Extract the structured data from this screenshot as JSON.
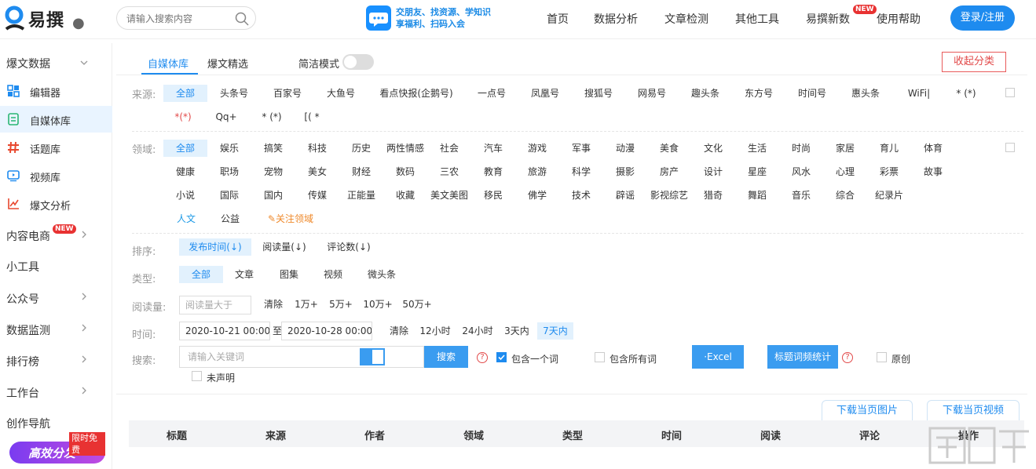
{
  "header": {
    "logo_text": "易撰",
    "search_placeholder": "请输入搜索内容",
    "promo_line1": "交朋友、找资源、学知识",
    "promo_line2": "享福利、扫码入会",
    "nav": [
      "首页",
      "数据分析",
      "文章检测",
      "其他工具",
      "易撰新数",
      "使用帮助"
    ],
    "new_badge": "NEW",
    "login_label": "登录/注册"
  },
  "sidebar": {
    "section_title": "爆文数据",
    "items": [
      {
        "label": "编辑器",
        "icon": "grid-icon"
      },
      {
        "label": "自媒体库",
        "icon": "document-icon"
      },
      {
        "label": "话题库",
        "icon": "hashtag-icon"
      },
      {
        "label": "视频库",
        "icon": "video-icon"
      },
      {
        "label": "爆文分析",
        "icon": "chart-icon"
      }
    ],
    "groups": [
      "内容电商",
      "小工具",
      "公众号",
      "数据监测",
      "排行榜",
      "工作台",
      "创作导航"
    ],
    "new_badge": "NEW",
    "promo_text": "高效分发",
    "promo_badge": "限时免费"
  },
  "tabs": {
    "items": [
      "自媒体库",
      "爆文精选"
    ],
    "toggle_label": "简洁模式",
    "collapse_label": "收起分类"
  },
  "filters": {
    "source_label": "来源:",
    "sources_row1": [
      "全部",
      "头条号",
      "百家号",
      "大鱼号",
      "看点快报(企鹅号)",
      "一点号",
      "凤凰号",
      "搜狐号",
      "网易号",
      "趣头条",
      "东方号",
      "时间号",
      "惠头条",
      "WiFi|",
      "* (*)"
    ],
    "sources_row2": [
      "*(*)",
      "Qq+",
      "* (*)",
      "[( *"
    ],
    "domain_label": "领域:",
    "domains_row1": [
      "全部",
      "娱乐",
      "搞笑",
      "科技",
      "历史",
      "两性情感",
      "社会",
      "汽车",
      "游戏",
      "军事",
      "动漫",
      "美食",
      "文化",
      "生活",
      "时尚",
      "家居",
      "育儿",
      "体育"
    ],
    "domains_row2": [
      "健康",
      "职场",
      "宠物",
      "美女",
      "财经",
      "数码",
      "三农",
      "教育",
      "旅游",
      "科学",
      "摄影",
      "房产",
      "设计",
      "星座",
      "风水",
      "心理",
      "彩票",
      "故事"
    ],
    "domains_row3": [
      "小说",
      "国际",
      "国内",
      "传媒",
      "正能量",
      "收藏",
      "美文美图",
      "移民",
      "佛学",
      "技术",
      "辟谣",
      "影视综艺",
      "猎奇",
      "舞蹈",
      "音乐",
      "综合",
      "纪录片"
    ],
    "domains_row4": [
      "人文",
      "公益"
    ],
    "follow_domain": "关注领域",
    "sort_label": "排序:",
    "sorts": [
      "发布时间(↓)",
      "阅读量(↓)",
      "评论数(↓)"
    ],
    "type_label": "类型:",
    "types": [
      "全部",
      "文章",
      "图集",
      "视频",
      "微头条"
    ],
    "reads_label": "阅读量:",
    "reads_placeholder": "阅读量大于",
    "reads_clear": "清除",
    "reads_opts": [
      "1万+",
      "5万+",
      "10万+",
      "50万+"
    ],
    "time_label": "时间:",
    "time_start": "2020-10-21 00:00",
    "time_to": "至",
    "time_end": "2020-10-28 00:00",
    "time_clear": "清除",
    "time_opts": [
      "12小时",
      "24小时",
      "3天内",
      "7天内"
    ],
    "search_label": "搜索:",
    "keyword_placeholder": "请输入关键词",
    "search_button": "搜索",
    "help_glyph": "?",
    "contains_one": "包含一个词",
    "contains_all": "包含所有词",
    "excel_button": "·Excel",
    "freq_button": "标题词频统计",
    "original": "原创",
    "undeclared": "未声明"
  },
  "table": {
    "download_images": "下载当页图片",
    "download_videos": "下载当页视频",
    "headers": [
      "标题",
      "来源",
      "作者",
      "领域",
      "类型",
      "时间",
      "阅读",
      "评论",
      "操作"
    ]
  }
}
